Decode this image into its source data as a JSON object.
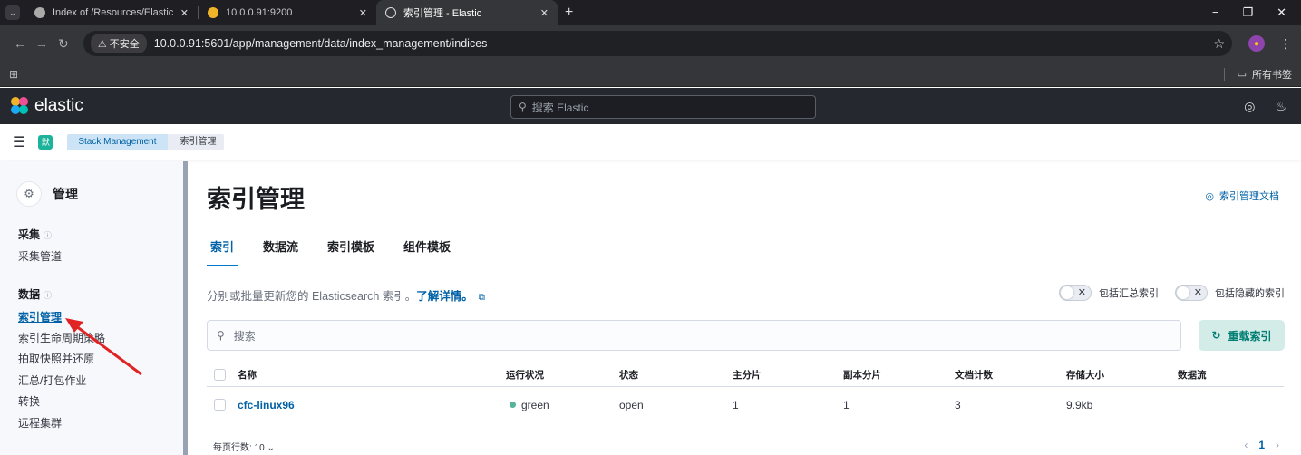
{
  "browser": {
    "tabs": [
      {
        "title": "Index of /Resources/ElasticSt",
        "active": false
      },
      {
        "title": "10.0.0.91:9200",
        "active": false
      },
      {
        "title": "索引管理 - Elastic",
        "active": true
      }
    ],
    "not_secure": "不安全",
    "url": "10.0.0.91:5601/app/management/data/index_management/indices",
    "all_bookmarks": "所有书签"
  },
  "kibana": {
    "logo_text": "elastic",
    "search_placeholder": "搜索 Elastic",
    "space_badge": "默",
    "breadcrumbs": [
      "Stack Management",
      "索引管理"
    ]
  },
  "sidebar": {
    "title": "管理",
    "groups": [
      {
        "label": "采集",
        "items": [
          "采集管道"
        ]
      },
      {
        "label": "数据",
        "items": [
          "索引管理",
          "索引生命周期策略",
          "拍取快照并还原",
          "汇总/打包作业",
          "转换",
          "远程集群"
        ]
      }
    ],
    "active_item": "索引管理"
  },
  "main": {
    "title": "索引管理",
    "doc_link": "索引管理文档",
    "tabs": [
      "索引",
      "数据流",
      "索引模板",
      "组件模板"
    ],
    "selected_tab": "索引",
    "description": "分别或批量更新您的 Elasticsearch 索引。",
    "learn_more": "了解详情。",
    "toggles": [
      "包括汇总索引",
      "包括隐藏的索引"
    ],
    "search_placeholder": "搜索",
    "reload_button": "重载索引",
    "table": {
      "columns": [
        "名称",
        "运行状况",
        "状态",
        "主分片",
        "副本分片",
        "文档计数",
        "存储大小",
        "数据流"
      ],
      "rows": [
        {
          "name": "cfc-linux96",
          "health": "green",
          "status": "open",
          "primary": "1",
          "replicas": "1",
          "docs": "3",
          "size": "9.9kb",
          "data_stream": ""
        }
      ]
    },
    "rows_per_page": "每页行数: 10",
    "page_current": "1"
  },
  "colors": {
    "accent": "#0061a6",
    "health_green": "#54b399",
    "reload_bg": "#d4ece8",
    "annotation_arrow": "#e02424"
  }
}
